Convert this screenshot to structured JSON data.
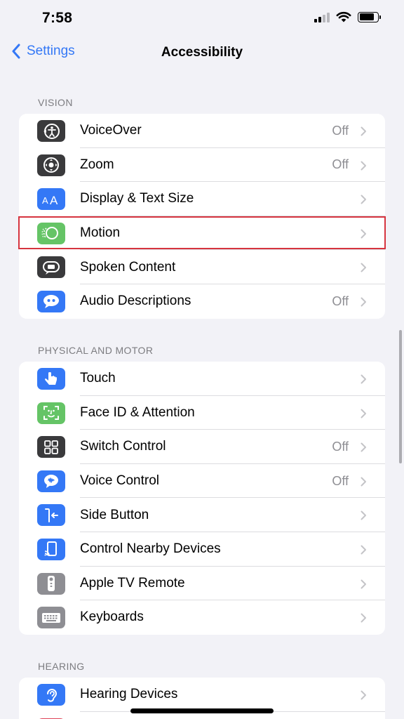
{
  "status_bar": {
    "time": "7:58",
    "battery_level": 0.8
  },
  "nav": {
    "back_label": "Settings",
    "title": "Accessibility"
  },
  "sections": [
    {
      "header": "VISION",
      "rows": [
        {
          "label": "VoiceOver",
          "value": "Off",
          "icon": "voiceover-icon",
          "color": "#3a3a3c"
        },
        {
          "label": "Zoom",
          "value": "Off",
          "icon": "zoom-icon",
          "color": "#3a3a3c"
        },
        {
          "label": "Display & Text Size",
          "value": "",
          "icon": "text-size-icon",
          "color": "#3478f6"
        },
        {
          "label": "Motion",
          "value": "",
          "icon": "motion-icon",
          "color": "#65c466"
        },
        {
          "label": "Spoken Content",
          "value": "",
          "icon": "spoken-content-icon",
          "color": "#3a3a3c"
        },
        {
          "label": "Audio Descriptions",
          "value": "Off",
          "icon": "audio-descriptions-icon",
          "color": "#3478f6"
        }
      ]
    },
    {
      "header": "PHYSICAL AND MOTOR",
      "rows": [
        {
          "label": "Touch",
          "value": "",
          "icon": "touch-icon",
          "color": "#3478f6"
        },
        {
          "label": "Face ID & Attention",
          "value": "",
          "icon": "face-id-icon",
          "color": "#65c466"
        },
        {
          "label": "Switch Control",
          "value": "Off",
          "icon": "switch-control-icon",
          "color": "#3a3a3c"
        },
        {
          "label": "Voice Control",
          "value": "Off",
          "icon": "voice-control-icon",
          "color": "#3478f6"
        },
        {
          "label": "Side Button",
          "value": "",
          "icon": "side-button-icon",
          "color": "#3478f6"
        },
        {
          "label": "Control Nearby Devices",
          "value": "",
          "icon": "nearby-devices-icon",
          "color": "#3478f6"
        },
        {
          "label": "Apple TV Remote",
          "value": "",
          "icon": "tv-remote-icon",
          "color": "#8e8e93"
        },
        {
          "label": "Keyboards",
          "value": "",
          "icon": "keyboard-icon",
          "color": "#8e8e93"
        }
      ]
    },
    {
      "header": "HEARING",
      "rows": [
        {
          "label": "Hearing Devices",
          "value": "",
          "icon": "hearing-devices-icon",
          "color": "#3478f6"
        }
      ]
    }
  ],
  "colors": {
    "accent": "#3478f6",
    "highlight": "#d6343f",
    "background": "#f2f2f7"
  }
}
